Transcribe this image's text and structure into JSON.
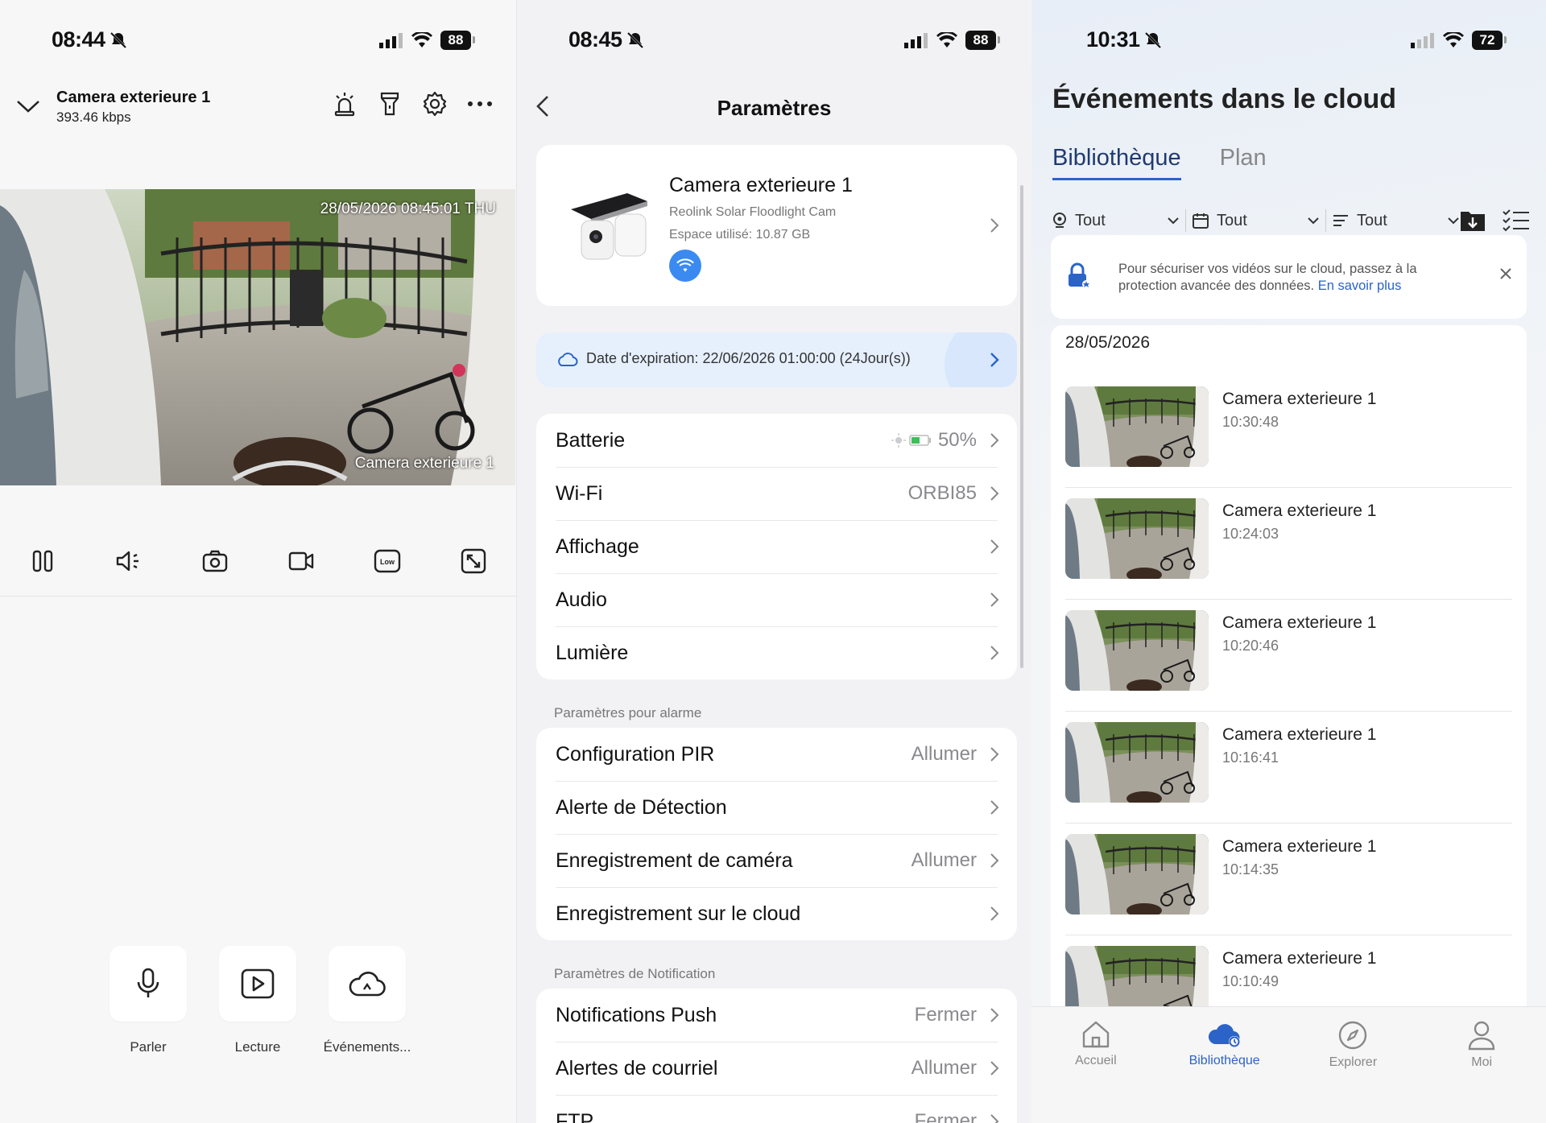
{
  "panel1": {
    "status": {
      "time": "08:44",
      "battery": "88"
    },
    "header": {
      "title": "Camera exterieure 1",
      "bitrate": "393.46 kbps"
    },
    "video": {
      "timestamp": "28/05/2026 08:45:01 THU",
      "camera_label": "Camera exterieure 1"
    },
    "controls": [
      "pause-icon",
      "volume-icon",
      "snapshot-icon",
      "record-icon",
      "quality-low-icon",
      "fullscreen-icon"
    ],
    "quality_label": "Low",
    "actions": [
      {
        "label": "Parler",
        "icon": "microphone-icon"
      },
      {
        "label": "Lecture",
        "icon": "playback-icon"
      },
      {
        "label": "Événements...",
        "icon": "cloud-icon"
      }
    ]
  },
  "panel2": {
    "status": {
      "time": "08:45",
      "battery": "88"
    },
    "title": "Paramètres",
    "device": {
      "name": "Camera exterieure 1",
      "model": "Reolink Solar Floodlight Cam",
      "storage": "Espace utilisé: 10.87 GB"
    },
    "expiration": "Date d'expiration: 22/06/2026 01:00:00 (24Jour(s))",
    "general": [
      {
        "label": "Batterie",
        "value": "50%"
      },
      {
        "label": "Wi-Fi",
        "value": "ORBI85"
      },
      {
        "label": "Affichage",
        "value": ""
      },
      {
        "label": "Audio",
        "value": ""
      },
      {
        "label": "Lumière",
        "value": ""
      }
    ],
    "alarm_section": "Paramètres pour alarme",
    "alarm": [
      {
        "label": "Configuration PIR",
        "value": "Allumer"
      },
      {
        "label": "Alerte de Détection",
        "value": ""
      },
      {
        "label": "Enregistrement de caméra",
        "value": "Allumer"
      },
      {
        "label": "Enregistrement sur le cloud",
        "value": ""
      }
    ],
    "notif_section": "Paramètres de Notification",
    "notif": [
      {
        "label": "Notifications Push",
        "value": "Fermer"
      },
      {
        "label": "Alertes de courriel",
        "value": "Allumer"
      },
      {
        "label": "FTP",
        "value": "Fermer"
      }
    ]
  },
  "panel3": {
    "status": {
      "time": "10:31",
      "battery": "72"
    },
    "title": "Événements dans le cloud",
    "tabs": [
      "Bibliothèque",
      "Plan"
    ],
    "filters": [
      "Tout",
      "Tout",
      "Tout"
    ],
    "banner": {
      "text": "Pour sécuriser vos vidéos sur le cloud, passez à la protection avancée des données.",
      "link": "En savoir plus"
    },
    "date": "28/05/2026",
    "events": [
      {
        "name": "Camera exterieure 1",
        "time": "10:30:48"
      },
      {
        "name": "Camera exterieure 1",
        "time": "10:24:03"
      },
      {
        "name": "Camera exterieure 1",
        "time": "10:20:46"
      },
      {
        "name": "Camera exterieure 1",
        "time": "10:16:41"
      },
      {
        "name": "Camera exterieure 1",
        "time": "10:14:35"
      },
      {
        "name": "Camera exterieure 1",
        "time": "10:10:49"
      }
    ],
    "tabbar": [
      {
        "label": "Accueil",
        "icon": "home-icon"
      },
      {
        "label": "Bibliothèque",
        "icon": "library-icon"
      },
      {
        "label": "Explorer",
        "icon": "compass-icon"
      },
      {
        "label": "Moi",
        "icon": "user-icon"
      }
    ]
  },
  "colors": {
    "accent": "#2b63c8",
    "wifi_badge": "#3a8af1",
    "expiry_bg": "#e6f0fd"
  }
}
